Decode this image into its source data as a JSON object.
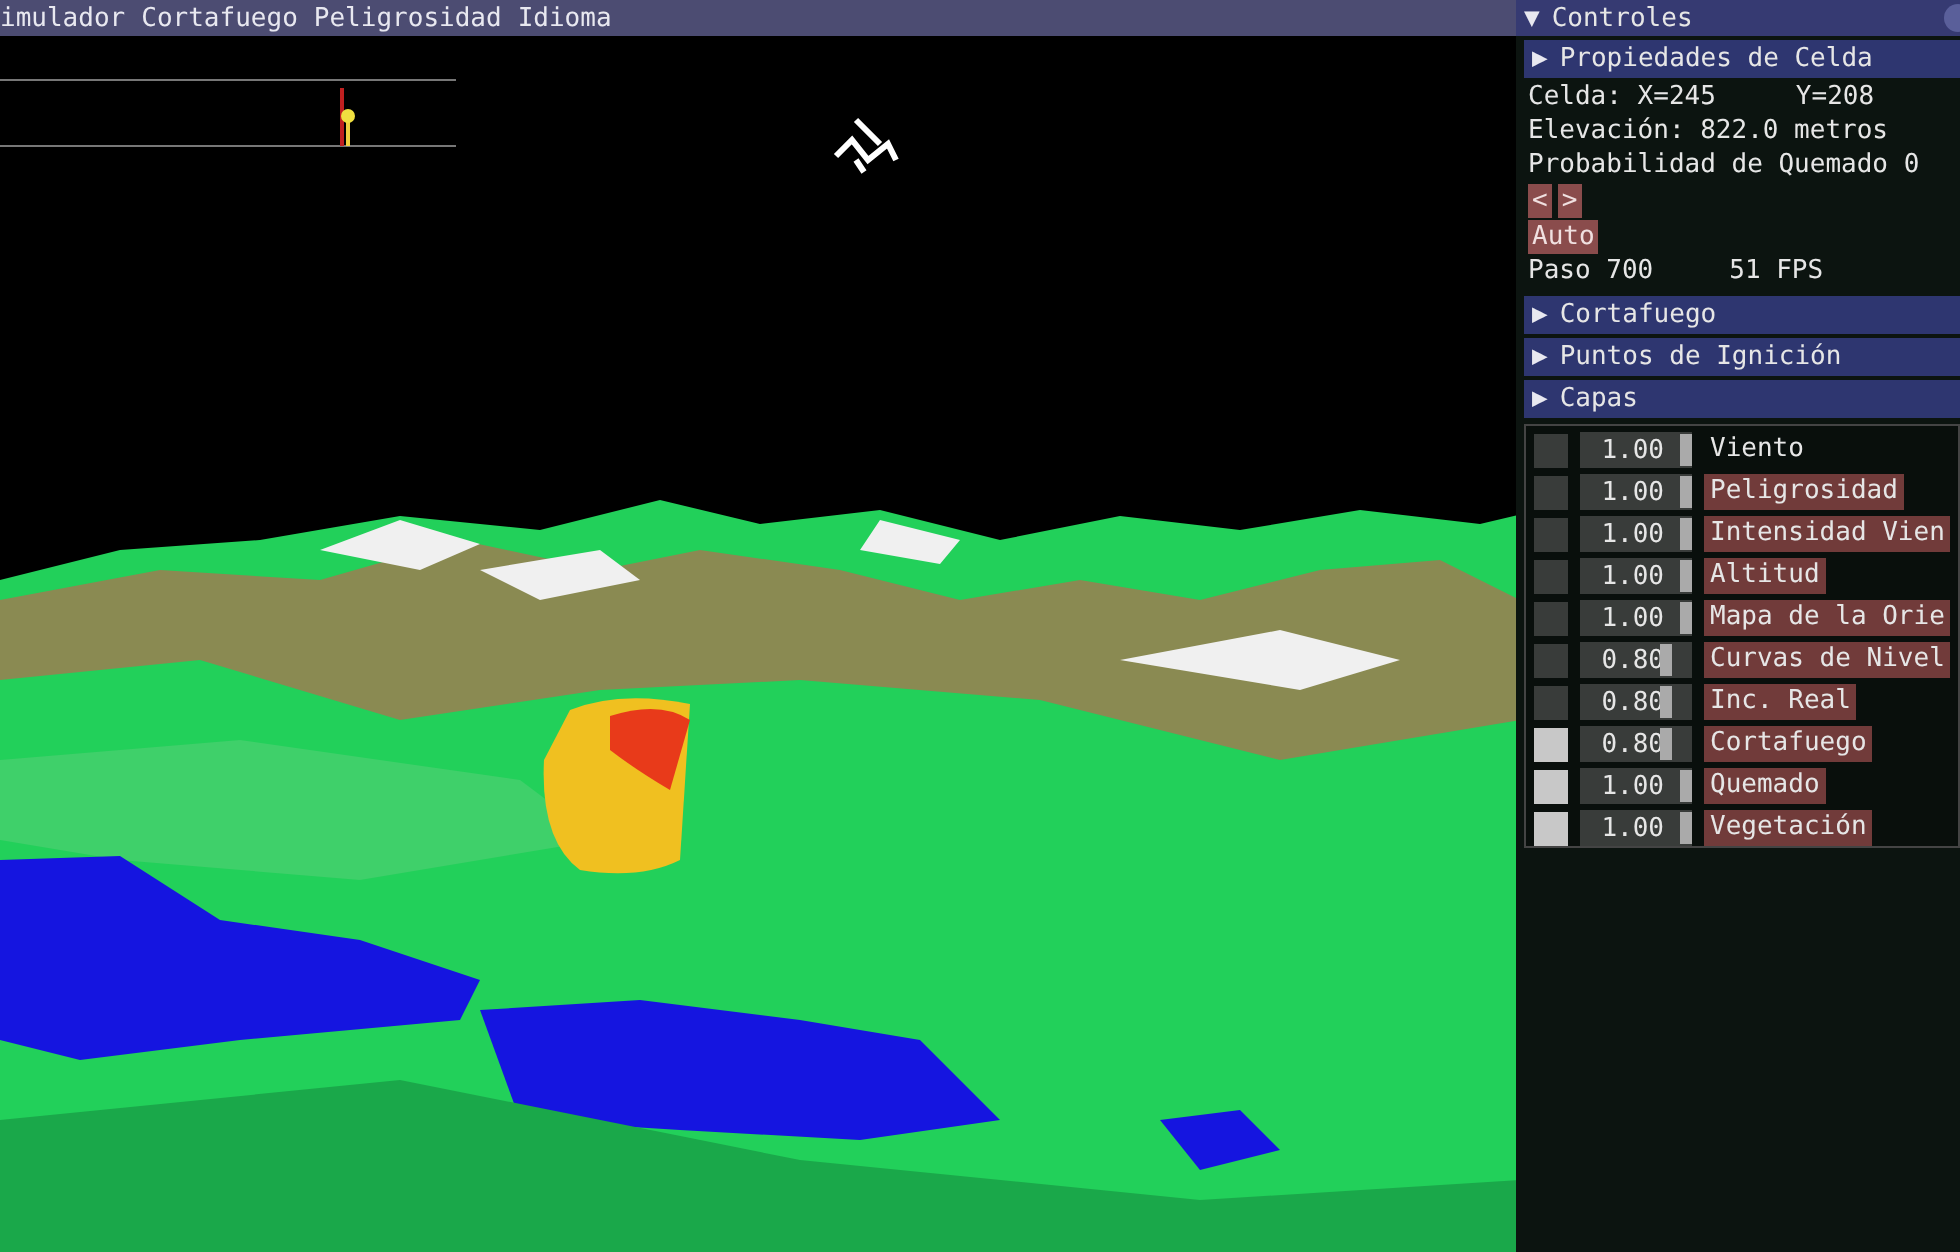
{
  "menu_bar": {
    "items": [
      "imulador",
      "Cortafuego",
      "Peligrosidad",
      "Idioma"
    ]
  },
  "controls": {
    "toggle": "▼",
    "title": "Controles",
    "cell_section": {
      "toggle": "▶",
      "title": "Propiedades de Celda",
      "cell_x": "Celda: X=245",
      "cell_y": "Y=208",
      "elevation": "Elevación: 822.0 metros",
      "burn_probability": "Probabilidad de Quemado 0",
      "step_buttons": [
        "<",
        ">"
      ],
      "auto_button": "Auto",
      "step": "Paso 700",
      "fps": "51 FPS"
    },
    "sections": [
      {
        "toggle": "▶",
        "title": "Cortafuego"
      },
      {
        "toggle": "▶",
        "title": "Puntos de Ignición"
      },
      {
        "toggle": "▶",
        "title": "Capas"
      }
    ],
    "layers": [
      {
        "checked": false,
        "value": "1.00",
        "level": 1,
        "label": "Viento",
        "highlighted": false
      },
      {
        "checked": false,
        "value": "1.00",
        "level": 1,
        "label": "Peligrosidad",
        "highlighted": true
      },
      {
        "checked": false,
        "value": "1.00",
        "level": 1,
        "label": "Intensidad Vien",
        "highlighted": true
      },
      {
        "checked": false,
        "value": "1.00",
        "level": 1,
        "label": "Altitud",
        "highlighted": true
      },
      {
        "checked": false,
        "value": "1.00",
        "level": 1,
        "label": "Mapa de la Orie",
        "highlighted": true
      },
      {
        "checked": false,
        "value": "0.80",
        "level": 0.8,
        "label": "Curvas de Nivel",
        "highlighted": true
      },
      {
        "checked": false,
        "value": "0.80",
        "level": 0.8,
        "label": "Inc. Real",
        "highlighted": true
      },
      {
        "checked": true,
        "value": "0.80",
        "level": 0.8,
        "label": "Cortafuego",
        "highlighted": true
      },
      {
        "checked": true,
        "value": "1.00",
        "level": 1,
        "label": "Quemado",
        "highlighted": true
      },
      {
        "checked": true,
        "value": "1.00",
        "level": 1,
        "label": "Vegetación",
        "highlighted": true
      }
    ]
  }
}
